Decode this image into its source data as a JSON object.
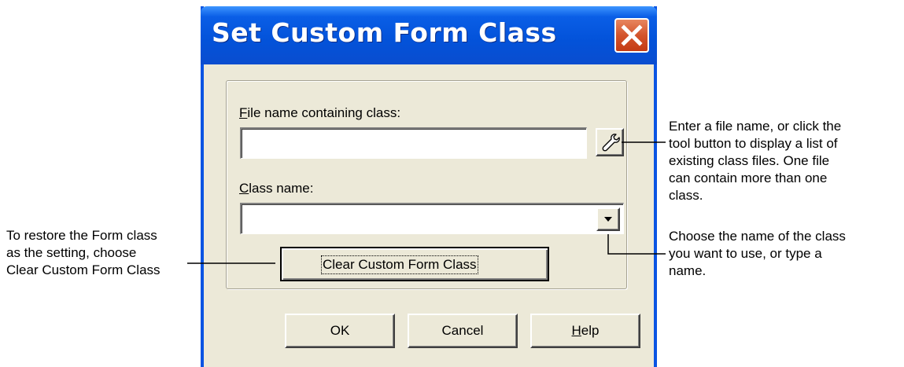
{
  "window": {
    "title": "Set Custom Form Class",
    "close_icon": "close-icon"
  },
  "form": {
    "file_label_accel": "F",
    "file_label_rest": "ile name containing class:",
    "file_value": "",
    "tool_button_icon": "wrench-icon",
    "class_label_accel": "C",
    "class_label_rest": "lass name:",
    "class_value": "",
    "combo_arrow_icon": "chevron-down-icon",
    "clear_button_label": "Clear Custom Form Class"
  },
  "buttons": {
    "ok": "OK",
    "cancel": "Cancel",
    "help_accel": "H",
    "help_rest": "elp"
  },
  "callouts": {
    "left": "To restore the Form class\nas the setting, choose\nClear Custom Form Class",
    "right_top": "Enter a file name, or click the\ntool button to display a list of\nexisting class files. One file\ncan contain more than one\nclass.",
    "right_bottom": "Choose the name of the class\nyou want to use, or type a\nname."
  },
  "colors": {
    "titlebar": "#0352d9",
    "dialog_face": "#ece9d8",
    "close_button": "#d3542c"
  }
}
